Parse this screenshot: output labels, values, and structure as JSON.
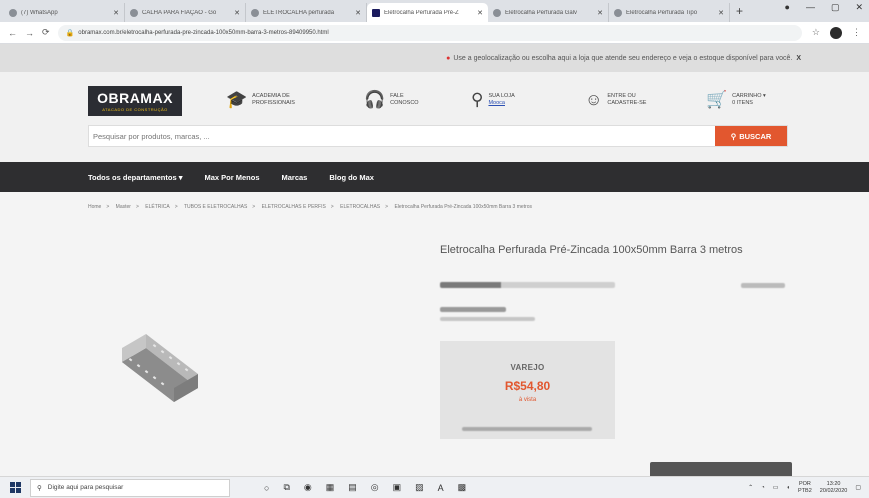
{
  "browser": {
    "tabs": [
      {
        "title": "(7) WhatsApp",
        "active": false
      },
      {
        "title": "CALHA PARA FIAÇÃO - Go",
        "active": false
      },
      {
        "title": "ELETROCALHA perfurada",
        "active": false
      },
      {
        "title": "Eletrocalha Perfurada Pré-Z",
        "active": true
      },
      {
        "title": "Eletrocalha Perfurada Galv",
        "active": false
      },
      {
        "title": "Eletrocalha Perfurada Tipo",
        "active": false
      }
    ],
    "new_tab": "+",
    "url": "obramax.com.br/eletrocalha-perfurada-pre-zincada-100x50mm-barra-3-metros-89409950.html",
    "window_controls": [
      "—",
      "▢",
      "✕"
    ]
  },
  "geo_banner": {
    "text": "Use a geolocalização ou escolha aqui a loja que atende seu endereço e veja o estoque disponível para você.",
    "close": "X"
  },
  "header": {
    "logo": "OBRAMAX",
    "logo_tagline": "ATACADO DE CONSTRUÇÃO",
    "items": [
      {
        "icon": "graduation-cap-icon",
        "glyph": "🎓",
        "line1": "ACADEMIA DE",
        "line2": "PROFISSIONAIS"
      },
      {
        "icon": "headset-icon",
        "glyph": "🎧",
        "line1": "FALE",
        "line2": "CONOSCO"
      },
      {
        "icon": "location-pin-icon",
        "glyph": "⚲",
        "line1": "SUA LOJA",
        "line2": "Mooca"
      },
      {
        "icon": "user-icon",
        "glyph": "☺",
        "line1": "ENTRE ou",
        "line2": "CADASTRE-SE"
      },
      {
        "icon": "cart-icon",
        "glyph": "🛒",
        "line1": "CARRINHO ▾",
        "line2": "0 itens"
      }
    ],
    "search_placeholder": "Pesquisar por produtos, marcas, ...",
    "search_button": "BUSCAR"
  },
  "nav": {
    "items": [
      "Todos os departamentos ▾",
      "Max Por Menos",
      "Marcas",
      "Blog do Max"
    ]
  },
  "breadcrumb": [
    "Home",
    "Master",
    "ELÉTRICA",
    "TUBOS E ELETROCALHAS",
    "ELETROCALHAS E PERFIS",
    "ELETROCALHAS",
    "Eletrocalha Perfurada Pré-Zincada 100x50mm Barra 3 metros"
  ],
  "product": {
    "title": "Eletrocalha Perfurada Pré-Zincada 100x50mm Barra 3 metros",
    "price_label": "VAREJO",
    "price": "R$54,80",
    "price_suffix": "à vista"
  },
  "taskbar": {
    "search_placeholder": "Digite aqui para pesquisar",
    "language": "POR",
    "layout": "PTB2",
    "time": "13:20",
    "date": "20/02/2020"
  }
}
